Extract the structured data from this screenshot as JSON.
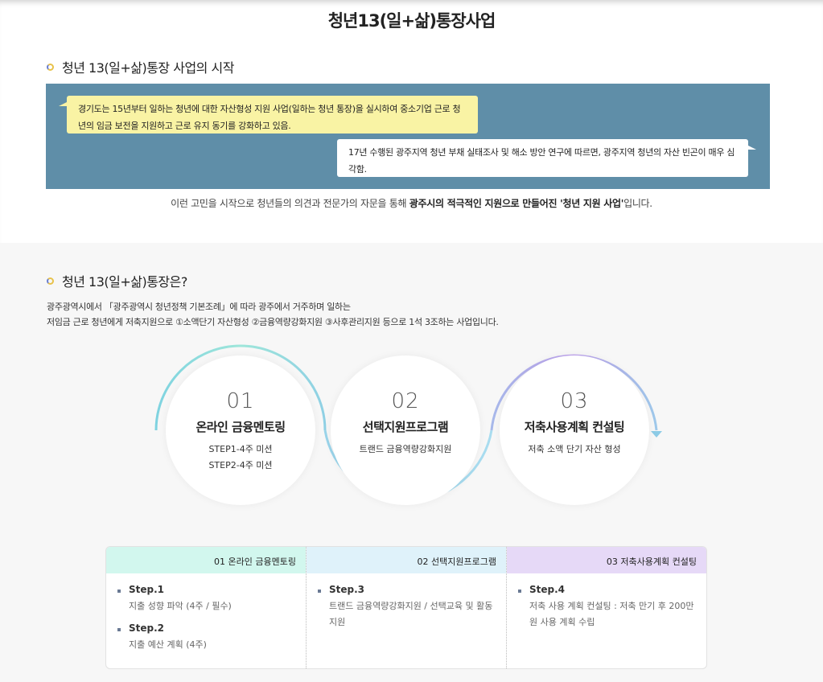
{
  "page_title": "청년13(일+삶)통장사업",
  "section1": {
    "heading": "청년 13(일+삶)통장 사업의 시작",
    "bubble1": "경기도는 15년부터 일하는 청년에 대한 자산형성 지원 사업(일하는 청년 통장)을 실시하여 중소기업 근로 청년의 임금 보전을 지원하고 근로 유지 동기를 강화하고 있음.",
    "bubble2": "17년 수행된 광주지역 청년 부채 실태조사 및 해소 방안 연구에 따르면, 광주지역 청년의 자산 빈곤이 매우 심각함.",
    "summary_pre": "이런 고민을 시작으로 청년들의 의견과 전문가의 자문을 통해 ",
    "summary_bold": "광주시의 적극적인 지원으로 만들어진 '청년 지원 사업'",
    "summary_post": "입니다."
  },
  "section2": {
    "heading": "청년 13(일+삶)통장은?",
    "intro_line1": "광주광역시에서 「광주광역시 청년정책 기본조례」에 따라 광주에서 거주하며 일하는",
    "intro_line2": "저임금 근로 청년에게 저축지원으로 ①소액단기 자산형성 ②금융역량강화지원 ③사후관리지원 등으로 1석 3조하는 사업입니다.",
    "circles": [
      {
        "num": "01",
        "name": "온라인 금융멘토링",
        "desc": [
          "STEP1-4주 미션",
          "STEP2-4주 미션"
        ]
      },
      {
        "num": "02",
        "name": "선택지원프로그램",
        "desc": [
          "트랜드 금융역량강화지원"
        ]
      },
      {
        "num": "03",
        "name": "저축사용계획 컨설팅",
        "desc": [
          "저축 소액 단기 자산 형성"
        ]
      }
    ],
    "columns": [
      {
        "header": "01 온라인 금융멘토링",
        "color": "#d2f7ee",
        "steps": [
          {
            "title": "Step.1",
            "desc": "지출 성향 파악 (4주 / 필수)"
          },
          {
            "title": "Step.2",
            "desc": "지출 예산 계획 (4주)"
          }
        ]
      },
      {
        "header": "02 선택지원프로그램",
        "color": "#dff2fa",
        "steps": [
          {
            "title": "Step.3",
            "desc": "트랜드 금융역량강화지원 / 선택교육 및 활동지원"
          }
        ]
      },
      {
        "header": "03 저축사용계획 컨설팅",
        "color": "#e6d9f7",
        "steps": [
          {
            "title": "Step.4",
            "desc": "저축 사용 계획 컨설팅 : 저축 만기 후 200만원 사용 계획 수립"
          }
        ]
      }
    ]
  }
}
